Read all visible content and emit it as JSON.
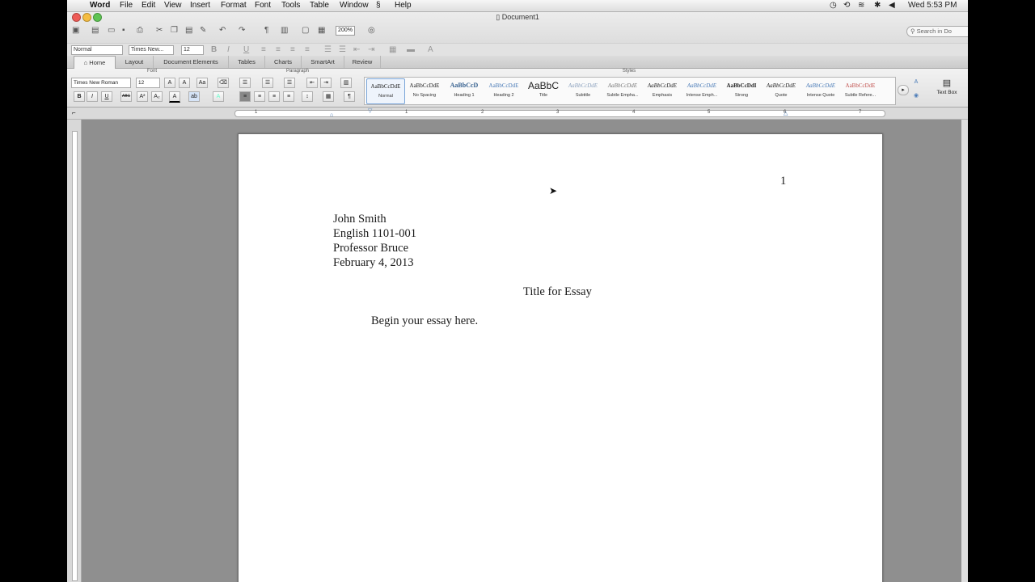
{
  "menubar": {
    "app_name": "Word",
    "items": [
      "File",
      "Edit",
      "View",
      "Insert",
      "Format",
      "Font",
      "Tools",
      "Table",
      "Window",
      "Help"
    ],
    "clock": "Wed 5:53 PM"
  },
  "window": {
    "title": "Document1",
    "zoom": "200%",
    "search_placeholder": "Search in Do"
  },
  "format_bar": {
    "style": "Normal",
    "font": "Times New...",
    "size": "12"
  },
  "ribbon_tabs": [
    "Home",
    "Layout",
    "Document Elements",
    "Tables",
    "Charts",
    "SmartArt",
    "Review"
  ],
  "ribbon": {
    "group_labels": {
      "font": "Font",
      "paragraph": "Paragraph",
      "styles": "Styles"
    },
    "font_name": "Times New Roman",
    "font_size": "12",
    "styles": [
      {
        "preview": "AaBbCcDdE",
        "name": "Normal"
      },
      {
        "preview": "AaBbCcDdE",
        "name": "No Spacing"
      },
      {
        "preview": "AaBbCcD",
        "name": "Heading 1"
      },
      {
        "preview": "AaBbCcDdE",
        "name": "Heading 2"
      },
      {
        "preview": "AaBbC",
        "name": "Title"
      },
      {
        "preview": "AaBbCcDdE",
        "name": "Subtitle"
      },
      {
        "preview": "AaBbCcDdE",
        "name": "Subtle Empha..."
      },
      {
        "preview": "AaBbCcDdE",
        "name": "Emphasis"
      },
      {
        "preview": "AaBbCcDdE",
        "name": "Intense Emph..."
      },
      {
        "preview": "AaBbCcDdI",
        "name": "Strong"
      },
      {
        "preview": "AaBbCcDdE",
        "name": "Quote"
      },
      {
        "preview": "AaBbCcDdE",
        "name": "Intense Quote"
      },
      {
        "preview": "AaBbCcDdE",
        "name": "Subtle Refere..."
      }
    ],
    "text_box_label": "Text Box"
  },
  "ruler_numbers": [
    "1",
    "1",
    "2",
    "3",
    "4",
    "5",
    "6",
    "7"
  ],
  "document": {
    "page_number": "1",
    "author": "John Smith",
    "course": "English 1101-001",
    "professor": "Professor Bruce",
    "date": "February 4, 2013",
    "title": "Title for Essay",
    "body": "Begin your essay here."
  }
}
